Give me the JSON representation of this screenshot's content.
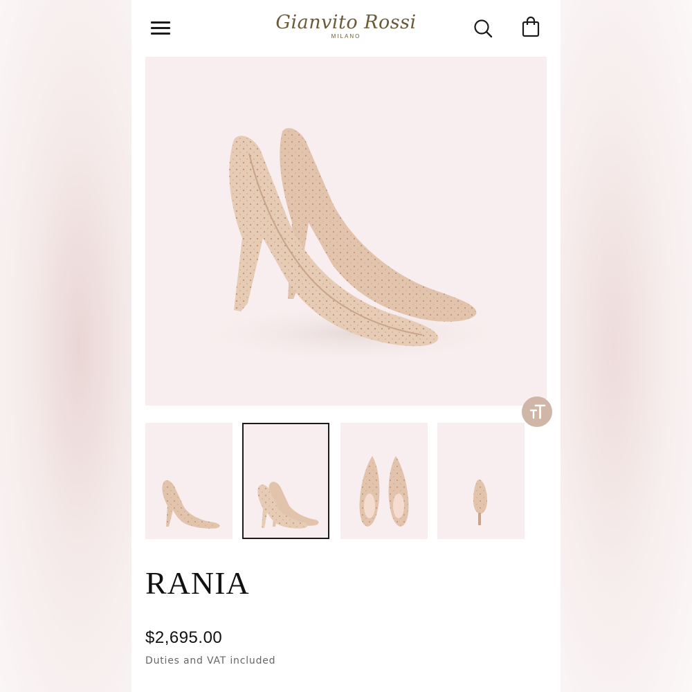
{
  "brand": {
    "logo_script": "Gianvito Rossi",
    "logo_subtitle": "MILANO"
  },
  "header": {
    "menu_icon": "hamburger-menu-icon",
    "search_icon": "search-icon",
    "bag_icon": "shopping-bag-icon"
  },
  "gallery": {
    "active_thumbnail_index": 1,
    "thumbnail_count": 4,
    "text_size_icon": "text-size-icon"
  },
  "product": {
    "name": "RANIA",
    "price": "$2,695.00",
    "tax_note": "Duties and VAT included"
  },
  "colors": {
    "image_background": "#f8eeef",
    "shoe_nude": "#e2c4ad",
    "crystal": "#b07c6e",
    "logo_gold": "#6b5a3a",
    "text_size_button": "#cfb6a7"
  }
}
